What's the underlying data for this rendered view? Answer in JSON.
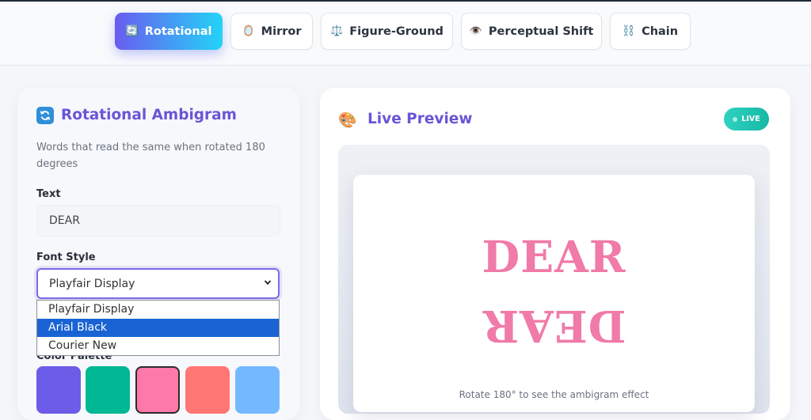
{
  "tabs": [
    {
      "label": "Rotational",
      "icon": "🔄",
      "active": true
    },
    {
      "label": "Mirror",
      "icon": "🪞",
      "active": false
    },
    {
      "label": "Figure-Ground",
      "icon": "⚖️",
      "active": false
    },
    {
      "label": "Perceptual Shift",
      "icon": "👁️",
      "active": false
    },
    {
      "label": "Chain",
      "icon": "⛓️",
      "active": false
    }
  ],
  "left_panel": {
    "title": "Rotational Ambigram",
    "description": "Words that read the same when rotated 180 degrees",
    "text_label": "Text",
    "text_value": "DEAR",
    "font_label": "Font Style",
    "font_selected": "Playfair Display",
    "font_options": [
      "Playfair Display",
      "Arial Black",
      "Courier New"
    ],
    "font_highlighted": "Arial Black",
    "color_label": "Color Palette",
    "colors": [
      "#6c5ce7",
      "#00b894",
      "#fd79a8",
      "#ff7675",
      "#74b9ff"
    ]
  },
  "preview": {
    "title": "Live Preview",
    "badge": "LIVE",
    "word": "DEAR",
    "caption": "Rotate 180° to see the ambigram effect",
    "color": "#f07aa8"
  }
}
